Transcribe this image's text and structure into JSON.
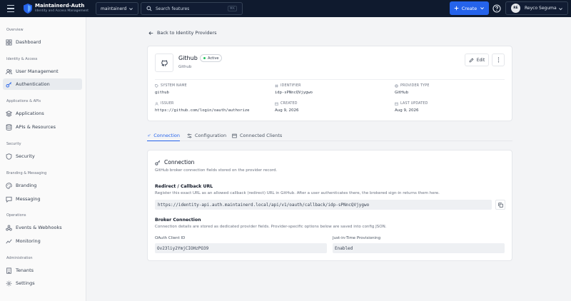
{
  "app": {
    "name": "Maintainerd-Auth",
    "subtitle": "Identity and Access Management"
  },
  "topbar": {
    "tenant": "maintainerd",
    "search_placeholder": "Search features",
    "search_shortcut": "⌘K",
    "create_label": "Create",
    "user_initials": "RE",
    "user_name": "Reyco Seguma"
  },
  "sidebar": {
    "sections": [
      {
        "title": "Overview",
        "items": [
          {
            "label": "Dashboard",
            "icon": "dashboard-icon"
          }
        ]
      },
      {
        "title": "Identity & Access",
        "items": [
          {
            "label": "User Management",
            "icon": "users-icon"
          },
          {
            "label": "Authentication",
            "icon": "key-icon",
            "active": true
          }
        ]
      },
      {
        "title": "Applications & APIs",
        "items": [
          {
            "label": "Applications",
            "icon": "applications-icon"
          },
          {
            "label": "APIs & Resources",
            "icon": "database-icon"
          }
        ]
      },
      {
        "title": "Security",
        "items": [
          {
            "label": "Security",
            "icon": "shield-icon"
          }
        ]
      },
      {
        "title": "Branding & Messaging",
        "items": [
          {
            "label": "Branding",
            "icon": "palette-icon"
          },
          {
            "label": "Messaging",
            "icon": "message-icon"
          }
        ]
      },
      {
        "title": "Operations",
        "items": [
          {
            "label": "Events & Webhooks",
            "icon": "webhook-icon"
          },
          {
            "label": "Monitoring",
            "icon": "activity-icon"
          }
        ]
      },
      {
        "title": "Administration",
        "items": [
          {
            "label": "Tenants",
            "icon": "building-icon"
          },
          {
            "label": "Settings",
            "icon": "gear-icon"
          }
        ]
      }
    ]
  },
  "page": {
    "back_label": "Back to Identity Providers",
    "provider": {
      "name": "Github",
      "subtitle": "Github",
      "status": "Active",
      "edit_label": "Edit"
    },
    "meta": {
      "system_name_label": "SYSTEM NAME",
      "system_name": "github",
      "identifier_label": "IDENTIFIER",
      "identifier": "idp-sPNncQVjygwo",
      "provider_type_label": "PROVIDER TYPE",
      "provider_type": "GitHub",
      "issuer_label": "ISSUER",
      "issuer": "https://github.com/login/oauth/authorize",
      "created_label": "CREATED",
      "created": "Aug 9, 2026",
      "last_updated_label": "LAST UPDATED",
      "last_updated": "Aug 9, 2026"
    },
    "tabs": [
      {
        "label": "Connection",
        "active": true
      },
      {
        "label": "Configuration"
      },
      {
        "label": "Connected Clients"
      }
    ],
    "connection": {
      "title": "Connection",
      "desc": "GitHub broker connection fields stored on the provider record.",
      "redirect_title": "Redirect / Callback URL",
      "redirect_desc": "Register this exact URL as an allowed callback (redirect) URL in GitHub. After a user authenticates there, the brokered sign-in returns them here.",
      "redirect_url": "https://identity-api.auth.maintainerd.local/api/v1/oauth/callback/idp-sPNncQVjygwo",
      "broker_title": "Broker Connection",
      "broker_desc": "Connection details are stored as dedicated provider fields. Provider-specific options below are saved into config JSON.",
      "client_id_label": "OAuth Client ID",
      "client_id": "Ov23liy2YmjCIOHzPO39",
      "jit_label": "Just-in-Time Provisioning",
      "jit_value": "Enabled"
    }
  }
}
